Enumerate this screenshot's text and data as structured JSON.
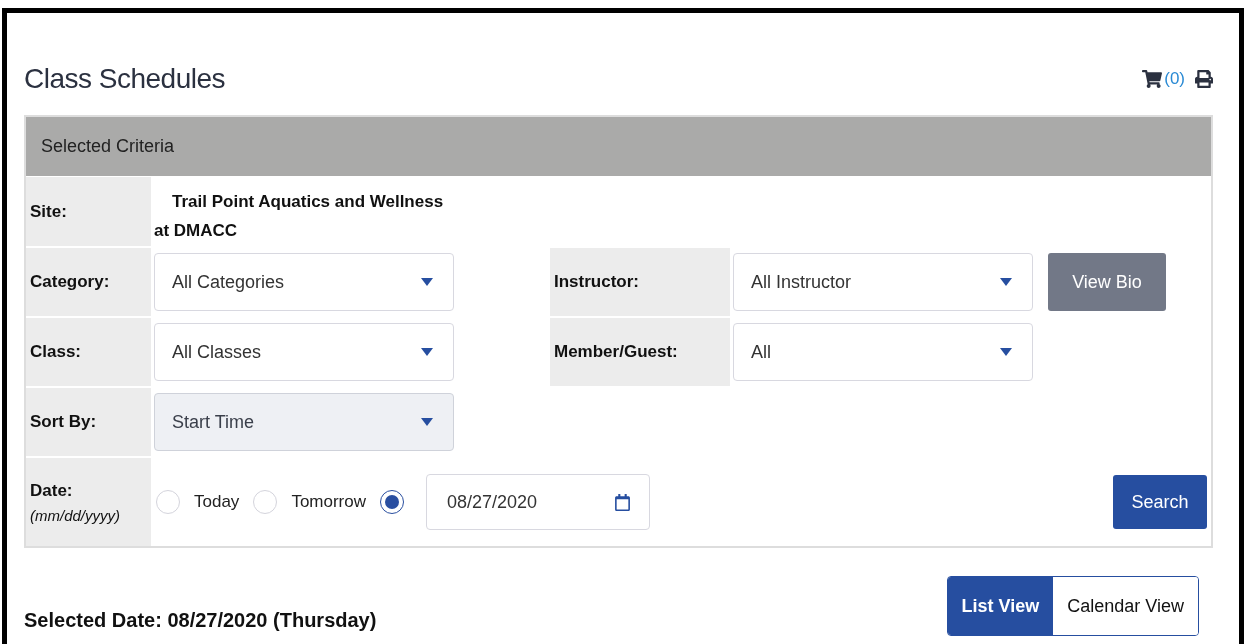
{
  "header": {
    "title": "Class Schedules",
    "cart_count": "(0)"
  },
  "criteria": {
    "title": "Selected Criteria",
    "site": {
      "label": "Site:",
      "value": "Trail Point Aquatics and Wellness at DMACC"
    },
    "rows": [
      {
        "left": {
          "label": "Category:",
          "value": "All Categories",
          "disabled": false
        },
        "right": {
          "label": "Instructor:",
          "value": "All Instructor",
          "disabled": false
        },
        "button": "View Bio"
      },
      {
        "left": {
          "label": "Class:",
          "value": "All Classes",
          "disabled": false
        },
        "right": {
          "label": "Member/Guest:",
          "value": "All",
          "disabled": false
        }
      },
      {
        "left": {
          "label": "Sort By:",
          "value": "Start Time",
          "disabled": true
        }
      }
    ],
    "date": {
      "label": "Date:",
      "hint": "(mm/dd/yyyy)",
      "options": [
        {
          "kind": "text",
          "label": "Today",
          "selected": false
        },
        {
          "kind": "text",
          "label": "Tomorrow",
          "selected": false
        },
        {
          "kind": "date",
          "value": "08/27/2020",
          "selected": true
        }
      ]
    },
    "search_button": "Search"
  },
  "selected_date": "Selected Date: 08/27/2020 (Thursday)",
  "view_toggle": [
    {
      "label": "List View",
      "selected": true
    },
    {
      "label": "Calendar View",
      "selected": false
    }
  ]
}
